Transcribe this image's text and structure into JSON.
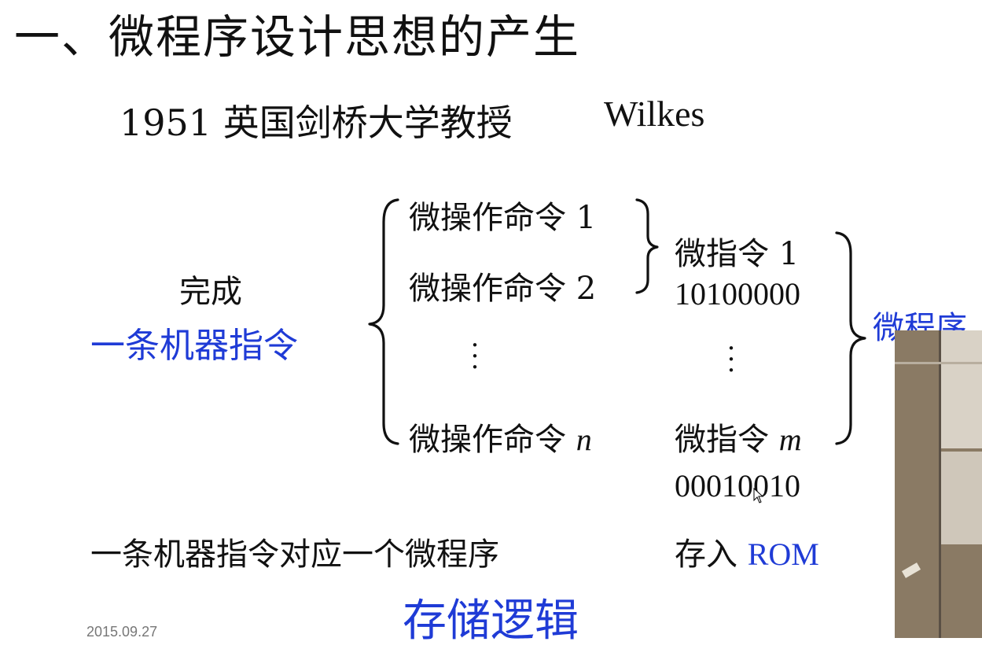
{
  "slide": {
    "title": "一、微程序设计思想的产生",
    "subtitle": "1951 英国剑桥大学教授",
    "subtitle_name": "Wilkes",
    "left_label_1": "完成",
    "left_label_2": "一条机器指令",
    "micro_ops": [
      {
        "label": "微操作命令 1"
      },
      {
        "label": "微操作命令 2"
      },
      {
        "label": "微操作命令 ",
        "suffix": "n"
      }
    ],
    "micro_instr_1": "微指令 1",
    "micro_instr_1_code": "10100000",
    "micro_instr_m": "微指令 ",
    "micro_instr_m_suffix": "m",
    "micro_instr_m_code": "00010010",
    "program_label": "微程序",
    "bottom_left": "一条机器指令对应一个微程序",
    "store_prefix": "存入",
    "store_target": "ROM",
    "bottom_center": "存储逻辑",
    "date": "2015.09.27"
  },
  "colors": {
    "text": "#111111",
    "accent_blue": "#1f3bd6",
    "background": "#ffffff"
  },
  "icons": {
    "cursor": "mouse-pointer-icon",
    "vertical_dots": "vertical-ellipsis-icon"
  }
}
